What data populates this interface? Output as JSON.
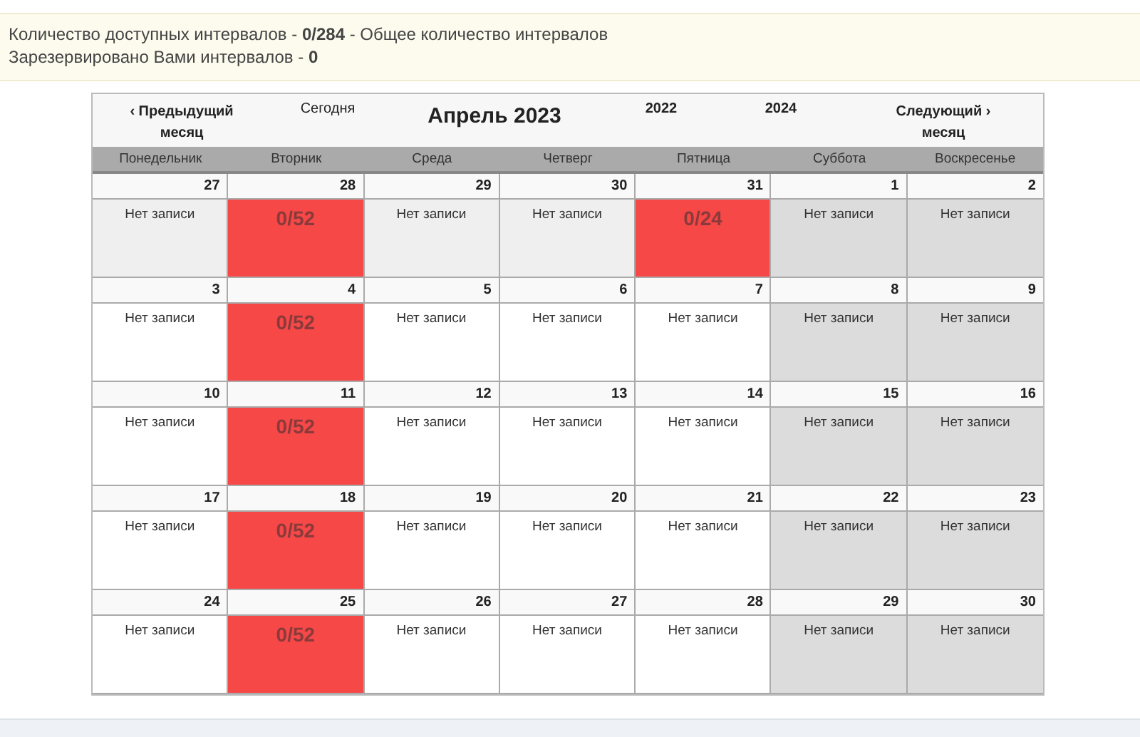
{
  "notice": {
    "lines": [
      "Количество доступных интервалов - **0/284** - Общее количество интервалов",
      "Зарезервировано Вами интервалов - **0**"
    ]
  },
  "calendar": {
    "prev": "‹ Предыдущий месяц",
    "today": "Сегодня",
    "title": "Апрель 2023",
    "year_prev": "2022",
    "year_next": "2024",
    "next": "Следующий › месяц",
    "weekdays": [
      "Понедельник",
      "Вторник",
      "Среда",
      "Четверг",
      "Пятница",
      "Суббота",
      "Воскресенье"
    ],
    "weeks": [
      {
        "days": [
          {
            "date": "27",
            "kind": "past",
            "text": "Нет записи"
          },
          {
            "date": "28",
            "kind": "booked",
            "text": "0/52"
          },
          {
            "date": "29",
            "kind": "past",
            "text": "Нет записи"
          },
          {
            "date": "30",
            "kind": "past",
            "text": "Нет записи"
          },
          {
            "date": "31",
            "kind": "booked",
            "text": "0/24"
          },
          {
            "date": "1",
            "kind": "weekend",
            "text": "Нет записи"
          },
          {
            "date": "2",
            "kind": "weekend",
            "text": "Нет записи"
          }
        ]
      },
      {
        "days": [
          {
            "date": "3",
            "kind": "empty",
            "text": "Нет записи"
          },
          {
            "date": "4",
            "kind": "booked",
            "text": "0/52"
          },
          {
            "date": "5",
            "kind": "empty",
            "text": "Нет записи"
          },
          {
            "date": "6",
            "kind": "empty",
            "text": "Нет записи"
          },
          {
            "date": "7",
            "kind": "empty",
            "text": "Нет записи"
          },
          {
            "date": "8",
            "kind": "weekend",
            "text": "Нет записи"
          },
          {
            "date": "9",
            "kind": "weekend",
            "text": "Нет записи"
          }
        ]
      },
      {
        "days": [
          {
            "date": "10",
            "kind": "empty",
            "text": "Нет записи"
          },
          {
            "date": "11",
            "kind": "booked",
            "text": "0/52"
          },
          {
            "date": "12",
            "kind": "empty",
            "text": "Нет записи"
          },
          {
            "date": "13",
            "kind": "empty",
            "text": "Нет записи"
          },
          {
            "date": "14",
            "kind": "empty",
            "text": "Нет записи"
          },
          {
            "date": "15",
            "kind": "weekend",
            "text": "Нет записи"
          },
          {
            "date": "16",
            "kind": "weekend",
            "text": "Нет записи"
          }
        ]
      },
      {
        "days": [
          {
            "date": "17",
            "kind": "empty",
            "text": "Нет записи"
          },
          {
            "date": "18",
            "kind": "booked",
            "text": "0/52"
          },
          {
            "date": "19",
            "kind": "empty",
            "text": "Нет записи"
          },
          {
            "date": "20",
            "kind": "empty",
            "text": "Нет записи"
          },
          {
            "date": "21",
            "kind": "empty",
            "text": "Нет записи"
          },
          {
            "date": "22",
            "kind": "weekend",
            "text": "Нет записи"
          },
          {
            "date": "23",
            "kind": "weekend",
            "text": "Нет записи"
          }
        ]
      },
      {
        "days": [
          {
            "date": "24",
            "kind": "empty",
            "text": "Нет записи"
          },
          {
            "date": "25",
            "kind": "booked",
            "text": "0/52"
          },
          {
            "date": "26",
            "kind": "empty",
            "text": "Нет записи"
          },
          {
            "date": "27",
            "kind": "empty",
            "text": "Нет записи"
          },
          {
            "date": "28",
            "kind": "empty",
            "text": "Нет записи"
          },
          {
            "date": "29",
            "kind": "weekend",
            "text": "Нет записи"
          },
          {
            "date": "30",
            "kind": "weekend",
            "text": "Нет записи"
          }
        ]
      }
    ]
  }
}
